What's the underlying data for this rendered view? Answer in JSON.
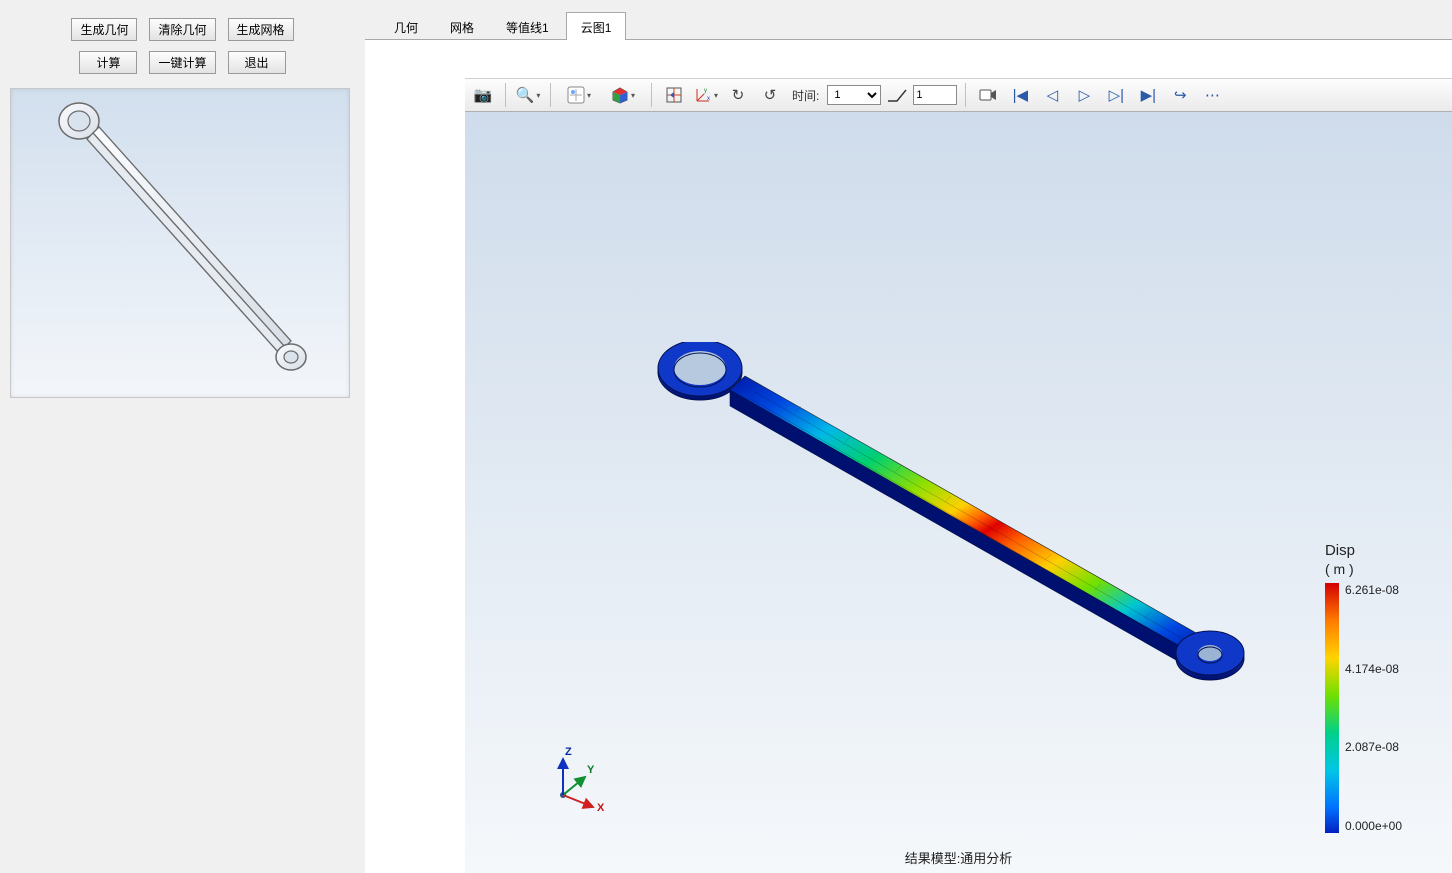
{
  "buttons": {
    "gen_geom": "生成几何",
    "clear_geom": "清除几何",
    "gen_mesh": "生成网格",
    "compute": "计算",
    "one_click": "一键计算",
    "exit": "退出"
  },
  "tabs": {
    "geom": "几何",
    "mesh": "网格",
    "contour1": "等值线1",
    "cloud1": "云图1"
  },
  "toolbar": {
    "time_label": "时间:",
    "time_value": "1",
    "frame_value": "1"
  },
  "legend": {
    "title": "Disp",
    "unit": "( m )",
    "max": "6.261e-08",
    "t2": "4.174e-08",
    "t3": "2.087e-08",
    "min": "0.000e+00"
  },
  "triad": {
    "x": "X",
    "y": "Y",
    "z": "Z"
  },
  "result_label": "结果模型:通用分析"
}
